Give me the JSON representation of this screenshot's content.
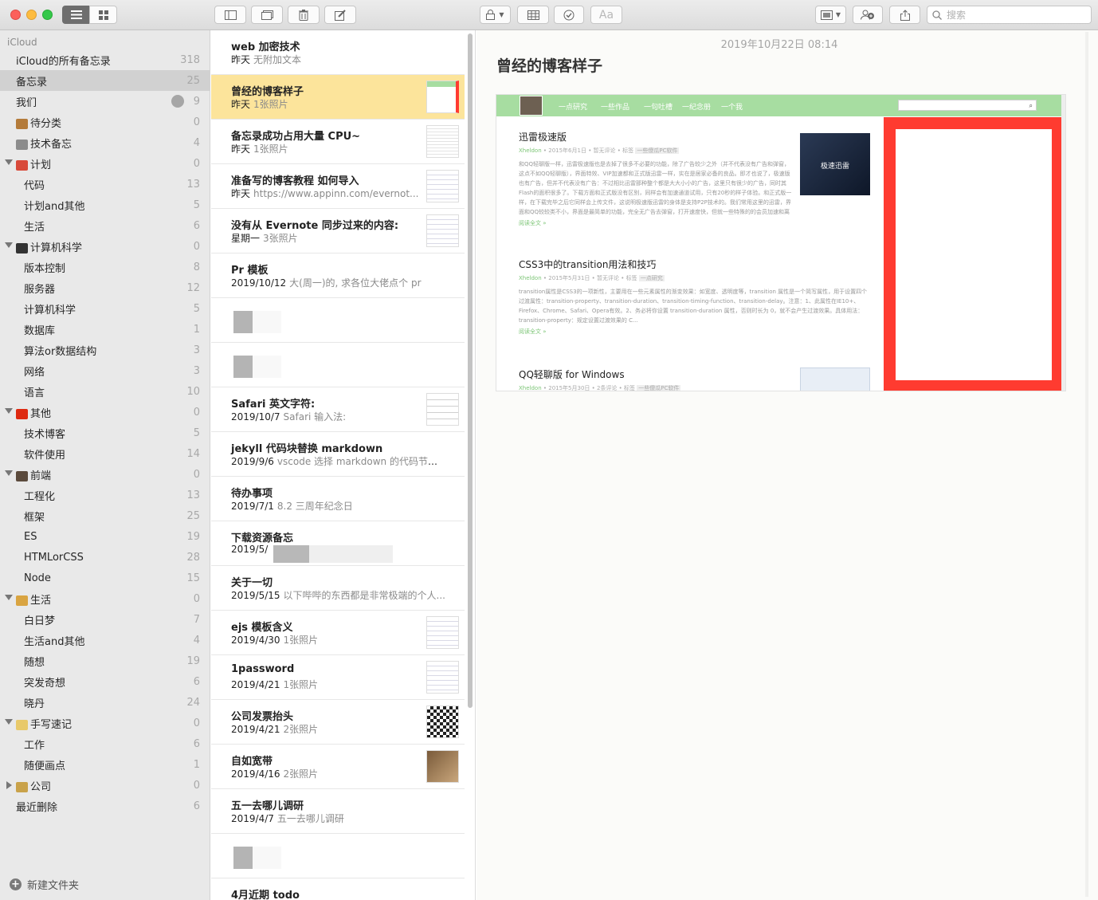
{
  "toolbar": {
    "search_placeholder": "搜索",
    "format_label": "Aa"
  },
  "sidebar": {
    "account": "iCloud",
    "new_folder": "新建文件夹",
    "items": [
      {
        "label": "iCloud的所有备忘录",
        "count": "318",
        "indent": 20,
        "emoji": null,
        "expand": null,
        "selected": false
      },
      {
        "label": "备忘录",
        "count": "25",
        "indent": 20,
        "emoji": null,
        "expand": null,
        "selected": true
      },
      {
        "label": "我们",
        "count": "9",
        "indent": 20,
        "emoji": null,
        "expand": null,
        "selected": false,
        "shared": true
      },
      {
        "label": "待分类",
        "count": "0",
        "indent": 20,
        "emoji": "#b47b3a",
        "expand": null,
        "selected": false
      },
      {
        "label": "技术备忘",
        "count": "4",
        "indent": 20,
        "emoji": "#8c8c8c",
        "expand": null,
        "selected": false
      },
      {
        "label": "计划",
        "count": "0",
        "indent": 20,
        "emoji": "#d84a3a",
        "expand": "down",
        "selected": false
      },
      {
        "label": "代码",
        "count": "13",
        "indent": 30,
        "emoji": null,
        "expand": null,
        "selected": false
      },
      {
        "label": "计划and其他",
        "count": "5",
        "indent": 30,
        "emoji": null,
        "expand": null,
        "selected": false
      },
      {
        "label": "生活",
        "count": "6",
        "indent": 30,
        "emoji": null,
        "expand": null,
        "selected": false
      },
      {
        "label": "计算机科学",
        "count": "0",
        "indent": 20,
        "emoji": "#333333",
        "expand": "down",
        "selected": false
      },
      {
        "label": "版本控制",
        "count": "8",
        "indent": 30,
        "emoji": null,
        "expand": null,
        "selected": false
      },
      {
        "label": "服务器",
        "count": "12",
        "indent": 30,
        "emoji": null,
        "expand": null,
        "selected": false
      },
      {
        "label": "计算机科学",
        "count": "5",
        "indent": 30,
        "emoji": null,
        "expand": null,
        "selected": false
      },
      {
        "label": "数据库",
        "count": "1",
        "indent": 30,
        "emoji": null,
        "expand": null,
        "selected": false
      },
      {
        "label": "算法or数据结构",
        "count": "3",
        "indent": 30,
        "emoji": null,
        "expand": null,
        "selected": false
      },
      {
        "label": "网络",
        "count": "3",
        "indent": 30,
        "emoji": null,
        "expand": null,
        "selected": false
      },
      {
        "label": "语言",
        "count": "10",
        "indent": 30,
        "emoji": null,
        "expand": null,
        "selected": false
      },
      {
        "label": "其他",
        "count": "0",
        "indent": 20,
        "emoji": "#de2910",
        "expand": "down",
        "selected": false
      },
      {
        "label": "技术博客",
        "count": "5",
        "indent": 30,
        "emoji": null,
        "expand": null,
        "selected": false
      },
      {
        "label": "软件使用",
        "count": "14",
        "indent": 30,
        "emoji": null,
        "expand": null,
        "selected": false
      },
      {
        "label": "前端",
        "count": "0",
        "indent": 20,
        "emoji": "#5b4a3c",
        "expand": "down",
        "selected": false
      },
      {
        "label": "工程化",
        "count": "13",
        "indent": 30,
        "emoji": null,
        "expand": null,
        "selected": false
      },
      {
        "label": "框架",
        "count": "25",
        "indent": 30,
        "emoji": null,
        "expand": null,
        "selected": false
      },
      {
        "label": "ES",
        "count": "19",
        "indent": 30,
        "emoji": null,
        "expand": null,
        "selected": false
      },
      {
        "label": "HTMLorCSS",
        "count": "28",
        "indent": 30,
        "emoji": null,
        "expand": null,
        "selected": false
      },
      {
        "label": "Node",
        "count": "15",
        "indent": 30,
        "emoji": null,
        "expand": null,
        "selected": false
      },
      {
        "label": "生活",
        "count": "0",
        "indent": 20,
        "emoji": "#d9a441",
        "expand": "down",
        "selected": false
      },
      {
        "label": "白日梦",
        "count": "7",
        "indent": 30,
        "emoji": null,
        "expand": null,
        "selected": false
      },
      {
        "label": "生活and其他",
        "count": "4",
        "indent": 30,
        "emoji": null,
        "expand": null,
        "selected": false
      },
      {
        "label": "随想",
        "count": "19",
        "indent": 30,
        "emoji": null,
        "expand": null,
        "selected": false
      },
      {
        "label": "突发奇想",
        "count": "6",
        "indent": 30,
        "emoji": null,
        "expand": null,
        "selected": false
      },
      {
        "label": "晓丹",
        "count": "24",
        "indent": 30,
        "emoji": null,
        "expand": null,
        "selected": false
      },
      {
        "label": "手写速记",
        "count": "0",
        "indent": 20,
        "emoji": "#e8c96a",
        "expand": "down",
        "selected": false
      },
      {
        "label": "工作",
        "count": "6",
        "indent": 30,
        "emoji": null,
        "expand": null,
        "selected": false
      },
      {
        "label": "随便画点",
        "count": "1",
        "indent": 30,
        "emoji": null,
        "expand": null,
        "selected": false
      },
      {
        "label": "公司",
        "count": "0",
        "indent": 20,
        "emoji": "#c9a24a",
        "expand": "right",
        "selected": false
      },
      {
        "label": "最近删除",
        "count": "6",
        "indent": 20,
        "emoji": null,
        "expand": null,
        "selected": false
      }
    ]
  },
  "notes": [
    {
      "title": "web 加密技术",
      "date": "昨天",
      "snippet": "无附加文本",
      "thumb": null,
      "selected": false
    },
    {
      "title": "曾经的博客样子",
      "date": "昨天",
      "snippet": "1张照片",
      "thumb": "web",
      "selected": true
    },
    {
      "title": "备忘录成功占用大量 CPU~",
      "date": "昨天",
      "snippet": "1张照片",
      "thumb": "table",
      "selected": false
    },
    {
      "title": "准备写的博客教程 如何导入",
      "date": "昨天",
      "snippet": "https://www.appinn.com/evernot...",
      "thumb": "doc",
      "selected": false
    },
    {
      "title": "没有从 Evernote 同步过来的内容:",
      "date": "星期一",
      "snippet": "3张照片",
      "thumb": "doc",
      "selected": false
    },
    {
      "title": "Pr 模板",
      "date": "2019/10/12",
      "snippet": "大(周一)的, 求各位大佬点个 pr",
      "thumb": null,
      "selected": false
    },
    {
      "title": "",
      "date": "",
      "snippet": "",
      "thumb": null,
      "selected": false,
      "blurred": true
    },
    {
      "title": "",
      "date": "",
      "snippet": "",
      "thumb": null,
      "selected": false,
      "blurred": true
    },
    {
      "title": "Safari 英文字符:",
      "date": "2019/10/7",
      "snippet": "Safari 输入法:",
      "thumb": "text",
      "selected": false
    },
    {
      "title": "jekyll 代码块替换 markdown",
      "date": "2019/9/6",
      "snippet": "vscode 选择 markdown 的代码节点...",
      "thumb": null,
      "selected": false
    },
    {
      "title": "待办事项",
      "date": "2019/7/1",
      "snippet": "8.2 三周年纪念日",
      "thumb": null,
      "selected": false
    },
    {
      "title": "下载资源备忘",
      "date": "2019/5/",
      "snippet": "",
      "thumb": null,
      "selected": false,
      "partial_blur": true
    },
    {
      "title": "关于一切",
      "date": "2019/5/15",
      "snippet": "以下哔哔的东西都是非常极端的个人...",
      "thumb": null,
      "selected": false
    },
    {
      "title": "ejs 模板含义",
      "date": "2019/4/30",
      "snippet": "1张照片",
      "thumb": "doc",
      "selected": false
    },
    {
      "title": "1password",
      "date": "2019/4/21",
      "snippet": "1张照片",
      "thumb": "doc",
      "selected": false
    },
    {
      "title": "公司发票抬头",
      "date": "2019/4/21",
      "snippet": "2张照片",
      "thumb": "qr",
      "selected": false
    },
    {
      "title": "自如宽带",
      "date": "2019/4/16",
      "snippet": "2张照片",
      "thumb": "photo",
      "selected": false
    },
    {
      "title": "五一去哪儿调研",
      "date": "2019/4/7",
      "snippet": "五一去哪儿调研",
      "thumb": null,
      "selected": false
    },
    {
      "title": "",
      "date": "",
      "snippet": "",
      "thumb": null,
      "selected": false,
      "blurred": true
    },
    {
      "title": "4月近期 todo",
      "date": "",
      "snippet": "",
      "thumb": null,
      "selected": false
    }
  ],
  "editor": {
    "date": "2019年10月22日 08:14",
    "title": "曾经的博客样子",
    "screenshot": {
      "nav": [
        "一点研究",
        "一些作品",
        "一句吐槽",
        "一纪念册",
        "一个我"
      ],
      "posts": [
        {
          "title": "迅雷极速版",
          "meta_author": "Xheldon",
          "meta": "• 2015年6月1日 • 暂无评论 • 标签",
          "tag": "一些傻瓜PC软件",
          "body": "和QQ轻聊版一样，迅雷极速版也是去掉了很多不必要的功能，除了广告较少之外（并不代表没有广告和弹窗，这点不如QQ轻聊版），界面特效、VIP加速都和正式版迅雷一样，实在是居家必备的良品。即才也说了，极速版也有广告，但并不代表没有广告：不过相比迅雷那种整个都是大大小小的广告，这里只有很少的广告，同时其Flash的面积很多了。下载方面和正式版没有区别，同样会有加速通道试用，只有20秒的样子体验。和正式版一样，在下载完毕之后它同样会上传文件，这说明极速版迅雷的身体是支持P2P技术的。我们常用这里的迅雷，界面和QQ较较类不小，界面是最简单的功能，完全无广告去弹窗，打开速度快，但就一些特殊的的会员加速和离线等在有的，而且...",
          "more": "阅读全文 »",
          "image_title": "极速迅雷"
        },
        {
          "title": "CSS3中的transition用法和技巧",
          "meta_author": "Xheldon",
          "meta": "• 2015年5月31日 • 暂无评论 • 标签",
          "tag": "一点研究",
          "body": "transition属性是CSS3的一项新性，主要用在一些元素属性的渐变效果：如宽度、透明度等，transition 属性是一个简写属性，用于设置四个过渡属性：transition-property、transition-duration、transition-timing-function、transition-delay。注意：1、此属性在IE10+、Firefox、Chrome、Safari、Opera有效。2、务必将你设置 transition-duration 属性，否则时长为 0，就不会产生过渡效果。具体用法：transition-property：规定设置过渡效果的 C...",
          "more": "阅读全文 »"
        },
        {
          "title": "QQ轻聊版 for Windows",
          "meta_author": "Xheldon",
          "meta": "• 2015年5月30日 • 2条评论 • 标签",
          "tag": "一些傻瓜PC软件"
        }
      ]
    }
  }
}
